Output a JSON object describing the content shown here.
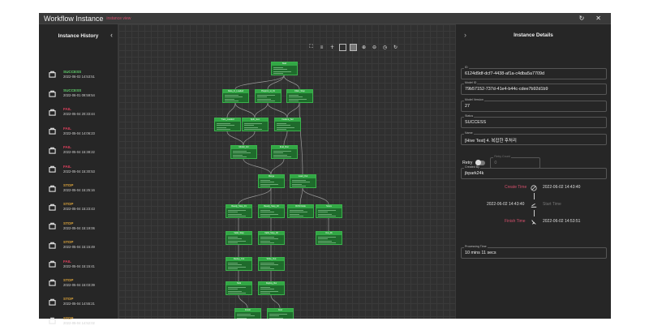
{
  "window": {
    "title": "Workflow Instance",
    "subtitle": "instance view",
    "refresh_icon": "refresh-icon",
    "close_icon": "close-icon"
  },
  "left_panel": {
    "title": "Instance History",
    "collapse_icon": "chevron-left-icon",
    "item_icon": "instance-icon",
    "status_colors": {
      "SUCCESS": "#5fce6a",
      "FAIL": "#e0405d",
      "STOP": "#d9a23a"
    },
    "items": [
      {
        "status": "SUCCESS",
        "date": "2022-06-02 14:53:51"
      },
      {
        "status": "SUCCESS",
        "date": "2022-06-01 09:59:54"
      },
      {
        "status": "FAIL",
        "date": "2022-05-04 20:33:44"
      },
      {
        "status": "FAIL",
        "date": "2022-05-04 14:06:23"
      },
      {
        "status": "FAIL",
        "date": "2022-05-04 15:38:22"
      },
      {
        "status": "FAIL",
        "date": "2022-05-04 15:30:53"
      },
      {
        "status": "STOP",
        "date": "2022-05-04 15:25:16"
      },
      {
        "status": "STOP",
        "date": "2022-05-04 15:23:43"
      },
      {
        "status": "STOP",
        "date": "2022-05-04 15:19:06"
      },
      {
        "status": "STOP",
        "date": "2022-05-04 15:15:49"
      },
      {
        "status": "FAIL",
        "date": "2022-05-04 15:15:41"
      },
      {
        "status": "STOP",
        "date": "2022-05-04 15:03:39"
      },
      {
        "status": "STOP",
        "date": "2022-05-04 14:55:21"
      },
      {
        "status": "STOP",
        "date": "2022-05-04 14:52:02"
      }
    ]
  },
  "toolbar": {
    "icons": [
      "fit-screen-icon",
      "layout-icon",
      "tree-icon",
      "grid-outline-icon",
      "grid-filled-icon",
      "zoom-in-icon",
      "zoom-out-icon",
      "reset-icon",
      "refresh-icon"
    ]
  },
  "graph": {
    "node_color": "#1f6b2c",
    "nodes": [
      {
        "id": "n1",
        "label": "Start"
      },
      {
        "id": "n2",
        "label": "Data_In_Loaded"
      },
      {
        "id": "n3",
        "label": "Preproc_st_01"
      },
      {
        "id": "n4",
        "label": "Filter_Step"
      },
      {
        "id": "n5",
        "label": "Train_Loaded"
      },
      {
        "id": "n6",
        "label": "Split_Gen"
      },
      {
        "id": "n7",
        "label": "Feature_Sel"
      },
      {
        "id": "n8",
        "label": "Model_Init"
      },
      {
        "id": "n9",
        "label": "Eval_Run"
      },
      {
        "id": "n10",
        "label": "Merge"
      },
      {
        "id": "n11",
        "label": "Load_Out"
      },
      {
        "id": "n12",
        "label": "Ready_Step_01"
      },
      {
        "id": "n13",
        "label": "Ready_Step_02"
      },
      {
        "id": "n14",
        "label": "RUN Node"
      },
      {
        "id": "n15",
        "label": "Score"
      },
      {
        "id": "n16",
        "label": "Valid_Step"
      },
      {
        "id": "n17",
        "label": "Valid_Step_02"
      },
      {
        "id": "n18",
        "label": "Out_01"
      },
      {
        "id": "n19",
        "label": "Dedup_Out"
      },
      {
        "id": "n20",
        "label": "Write_Out"
      },
      {
        "id": "n21",
        "label": "Sink"
      },
      {
        "id": "n22",
        "label": "Deploy_Rw"
      },
      {
        "id": "n23",
        "label": "Finish"
      },
      {
        "id": "n24",
        "label": "End"
      }
    ]
  },
  "right_panel": {
    "title": "Instance Details",
    "collapse_icon": "chevron-right-icon",
    "fields": [
      {
        "label": "ID",
        "value": "6124d9df-dcf7-4438-af1a-c4dba5a7709d"
      },
      {
        "label": "Model ID",
        "value": "79b57152-737d-41e4-b44c-cdee7b92d1b9"
      },
      {
        "label": "Model Version",
        "value": "27"
      },
      {
        "label": "Status",
        "value": "SUCCESS"
      },
      {
        "label": "Name",
        "value": "[Hive Test] 4. 복잡한 후처리"
      },
      {
        "label": "Created By",
        "value": "jbpark24k"
      },
      {
        "label": "Processing Time",
        "value": "10 mins 11 secs"
      }
    ],
    "retry": {
      "label": "Retry",
      "field_label": "Retry Count",
      "value": "0"
    },
    "timeline": {
      "create_label": "Create Time",
      "create_value": "2022-06-02 14:43:40",
      "start_label": "Start Time",
      "start_value": "2022-06-02 14:43:40",
      "finish_label": "Finish Time",
      "finish_value": "2022-06-02 14:53:51"
    }
  }
}
